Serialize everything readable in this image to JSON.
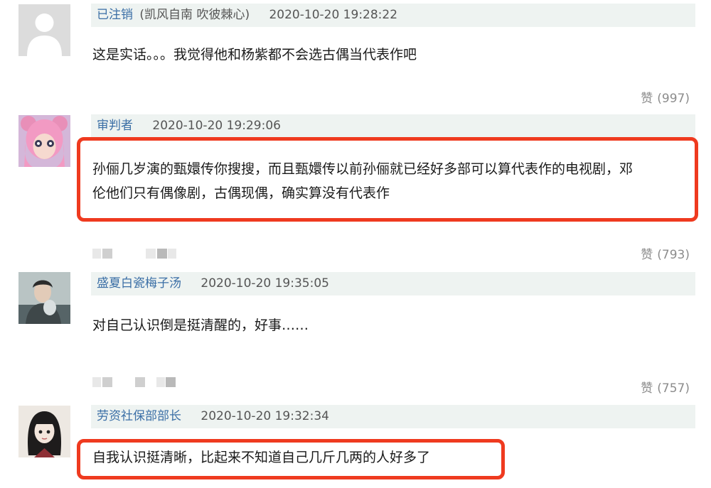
{
  "comments": [
    {
      "user": "已注销",
      "tag": "(凯风自南 吹彼棘心)",
      "time": "2020-10-20 19:28:22",
      "text_lines": [
        "这是实话。。。我觉得他和杨紫都不会选古偶当代表作吧"
      ],
      "likes_label": "赞",
      "likes_count": "(997)"
    },
    {
      "user": "审判者",
      "tag": "",
      "time": "2020-10-20 19:29:06",
      "text_lines": [
        "孙俪几岁演的甄嬛传你搜搜，而且甄嬛传以前孙俪就已经好多部可以算代表作的电视剧，邓",
        "伦他们只有偶像剧，古偶现偶，确实算没有代表作"
      ],
      "likes_label": "赞",
      "likes_count": "(793)"
    },
    {
      "user": "盛夏白瓷梅子汤",
      "tag": "",
      "time": "2020-10-20 19:35:05",
      "text_lines": [
        "对自己认识倒是挺清醒的，好事……"
      ],
      "likes_label": "赞",
      "likes_count": "(757)"
    },
    {
      "user": "劳资社保部部长",
      "tag": "",
      "time": "2020-10-20 19:32:34",
      "text_lines": [
        "自我认识挺清晰，比起来不知道自己几斤几两的人好多了"
      ],
      "likes_label": "",
      "likes_count": ""
    }
  ],
  "colors": {
    "username": "#3b6fa6",
    "header_bg": "#eef3f1",
    "highlight_border": "#ef3a1f",
    "likes": "#8c8c8c"
  },
  "icons": [
    "default-avatar-icon",
    "avatar-pink-hair",
    "avatar-man-portrait",
    "avatar-girl-drawing"
  ]
}
